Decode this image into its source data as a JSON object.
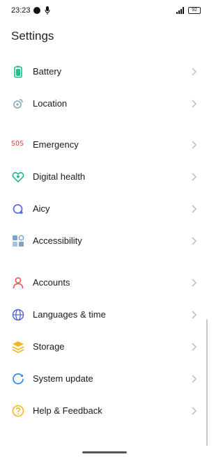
{
  "status": {
    "time": "23:23",
    "battery": "92"
  },
  "page": {
    "title": "Settings"
  },
  "groups": [
    {
      "items": [
        {
          "label": "Battery",
          "icon": "battery-icon"
        },
        {
          "label": "Location",
          "icon": "location-icon"
        }
      ]
    },
    {
      "items": [
        {
          "label": "Emergency",
          "icon": "sos-icon",
          "icon_text": "SOS"
        },
        {
          "label": "Digital health",
          "icon": "digital-health-icon"
        },
        {
          "label": "Aicy",
          "icon": "aicy-icon"
        },
        {
          "label": "Accessibility",
          "icon": "accessibility-icon"
        }
      ]
    },
    {
      "items": [
        {
          "label": "Accounts",
          "icon": "accounts-icon"
        },
        {
          "label": "Languages & time",
          "icon": "globe-icon"
        },
        {
          "label": "Storage",
          "icon": "storage-icon"
        },
        {
          "label": "System update",
          "icon": "system-update-icon"
        },
        {
          "label": "Help & Feedback",
          "icon": "help-icon"
        }
      ]
    }
  ],
  "colors": {
    "battery": "#1fc08a",
    "location": "#8aa6b8",
    "emergency": "#e23b3b",
    "digital_health": "#1fb894",
    "aicy": "#5b6ef0",
    "accessibility": "#7fa3c6",
    "accounts": "#f0554a",
    "languages": "#5a67d8",
    "storage": "#f2b61e",
    "system_update": "#2b8cf0",
    "help": "#f2b61e",
    "chevron": "#b8b8b8"
  }
}
